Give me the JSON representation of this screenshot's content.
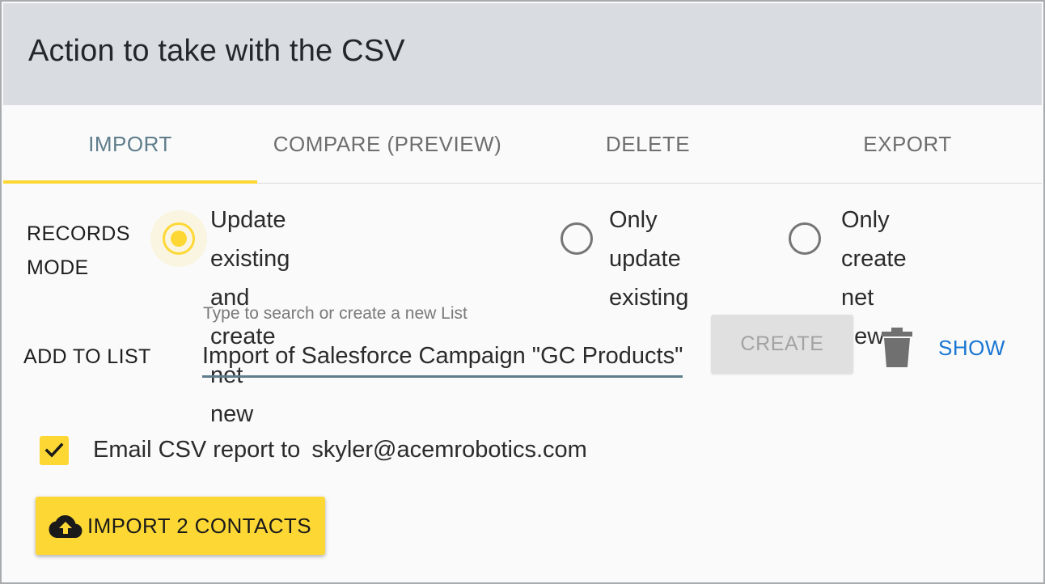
{
  "header": {
    "title": "Action to take with the CSV"
  },
  "tabs": [
    {
      "label": "IMPORT",
      "active": true
    },
    {
      "label": "COMPARE (PREVIEW)",
      "active": false
    },
    {
      "label": "DELETE",
      "active": false
    },
    {
      "label": "EXPORT",
      "active": false
    }
  ],
  "records_mode": {
    "label_line1": "RECORDS",
    "label_line2": "MODE",
    "options": [
      {
        "line1": "Update existing and create",
        "line2": "net new",
        "selected": true
      },
      {
        "line1": "Only update",
        "line2": "existing",
        "selected": false
      },
      {
        "line1": "Only create net",
        "line2": "new",
        "selected": false
      }
    ]
  },
  "add_to_list": {
    "label": "ADD TO LIST",
    "placeholder": "Type to search or create a new List",
    "value": "Import of Salesforce Campaign \"GC Products\"",
    "create_label": "CREATE",
    "show_label": "SHOW"
  },
  "email_report": {
    "checked": true,
    "label": "Email CSV report to",
    "email": "skyler@acemrobotics.com"
  },
  "import_button": {
    "label": "IMPORT 2 CONTACTS"
  },
  "colors": {
    "accent": "#fdd835",
    "active_tab": "#5f7d8c",
    "link": "#1976d2",
    "header_bg": "#d9dde1"
  },
  "icons": {
    "trash": "trash-icon",
    "cloud_upload": "cloud-upload-icon",
    "check": "check-icon"
  }
}
